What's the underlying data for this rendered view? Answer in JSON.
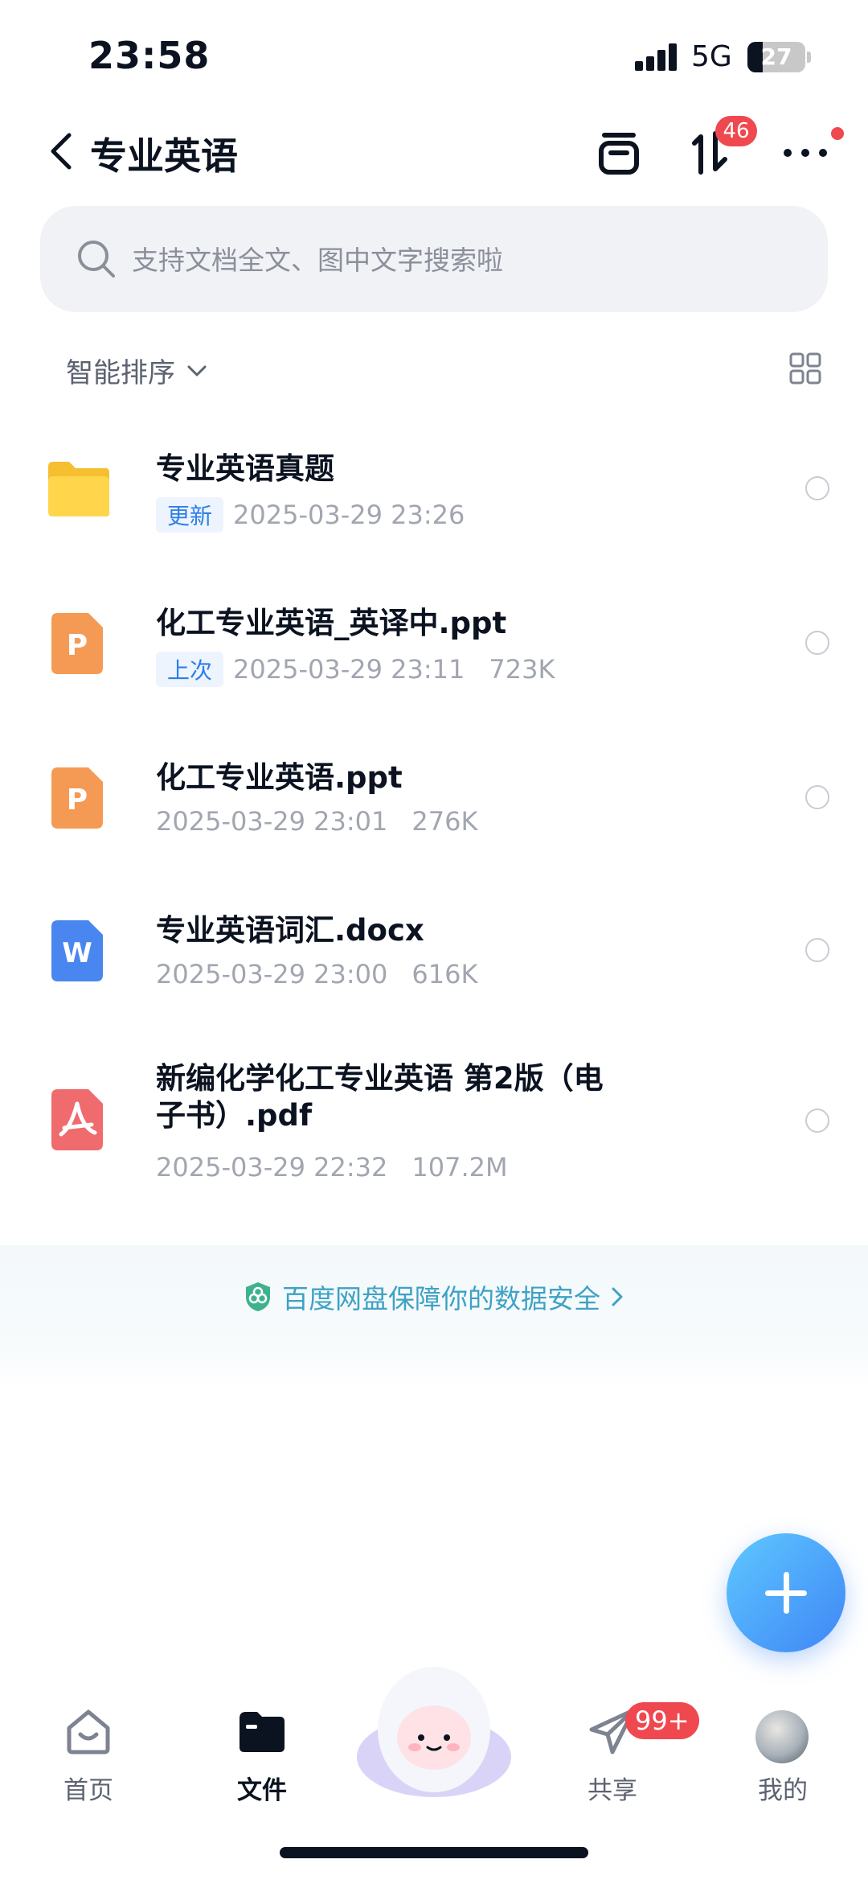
{
  "status_bar": {
    "time": "23:58",
    "network": "5G",
    "battery": "27",
    "battery_level": 0.27
  },
  "header": {
    "title": "专业英语",
    "transfer_badge": "46"
  },
  "search": {
    "placeholder": "支持文档全文、图中文字搜索啦"
  },
  "sort": {
    "label": "智能排序"
  },
  "files": [
    {
      "name": "专业英语真题",
      "type": "folder",
      "tag": "更新",
      "date": "2025-03-29 23:26",
      "size": ""
    },
    {
      "name": "化工专业英语_英译中.ppt",
      "type": "ppt",
      "tag": "上次",
      "date": "2025-03-29 23:11",
      "size": "723K"
    },
    {
      "name": "化工专业英语.ppt",
      "type": "ppt",
      "tag": "",
      "date": "2025-03-29 23:01",
      "size": "276K"
    },
    {
      "name": "专业英语词汇.docx",
      "type": "word",
      "tag": "",
      "date": "2025-03-29 23:00",
      "size": "616K"
    },
    {
      "name": "新编化学化工专业英语  第2版（电子书）.pdf",
      "type": "pdf",
      "tag": "",
      "date": "2025-03-29 22:32",
      "size": "107.2M"
    }
  ],
  "banner": {
    "text": "百度网盘保障你的数据安全"
  },
  "nav": {
    "home": "首页",
    "files": "文件",
    "share": "共享",
    "share_badge": "99+",
    "me": "我的"
  },
  "colors": {
    "accent": "#3f86f6",
    "badge": "#f0484f",
    "tag_blue": "#2d7ee8",
    "safety_text": "#3ea2c4"
  },
  "icons": [
    "back-icon",
    "recycle-box-icon",
    "transfer-icon",
    "more-icon",
    "search-icon",
    "chevron-down-icon",
    "grid-view-icon",
    "folder-icon",
    "ppt-file-icon",
    "word-file-icon",
    "pdf-file-icon",
    "shield-icon",
    "chevron-right-icon",
    "plus-icon",
    "home-icon",
    "folder-nav-icon",
    "share-plane-icon",
    "avatar"
  ]
}
